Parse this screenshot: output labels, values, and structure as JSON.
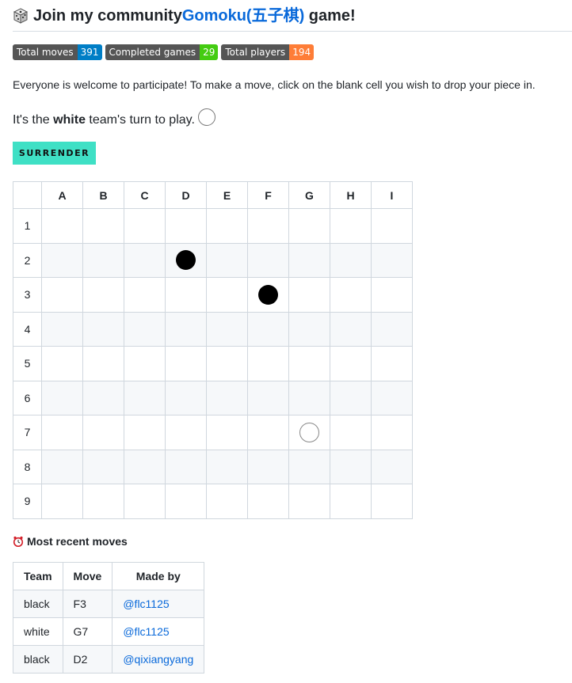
{
  "header": {
    "prefix": "Join my community ",
    "link_text": "Gomoku(五子棋)",
    "suffix": " game!",
    "icon": "dice-icon"
  },
  "badges": [
    {
      "label": "Total moves",
      "value": "391",
      "color": "#007ec6"
    },
    {
      "label": "Completed games",
      "value": "29",
      "color": "#4c1"
    },
    {
      "label": "Total players",
      "value": "194",
      "color": "#fe7d37"
    }
  ],
  "intro": "Everyone is welcome to participate! To make a move, click on the blank cell you wish to drop your piece in.",
  "turn": {
    "before": "It's the ",
    "team": "white",
    "after": " team's turn to play."
  },
  "surrender_label": "SURRENDER",
  "board": {
    "columns": [
      "A",
      "B",
      "C",
      "D",
      "E",
      "F",
      "G",
      "H",
      "I"
    ],
    "rows": [
      "1",
      "2",
      "3",
      "4",
      "5",
      "6",
      "7",
      "8",
      "9"
    ],
    "stones": [
      {
        "cell": "D2",
        "color": "black"
      },
      {
        "cell": "F3",
        "color": "black"
      },
      {
        "cell": "G7",
        "color": "white"
      }
    ]
  },
  "recent": {
    "title": "Most recent moves",
    "icon": "alarm-clock-icon",
    "headers": [
      "Team",
      "Move",
      "Made by"
    ],
    "rows": [
      {
        "team": "black",
        "move": "F3",
        "by": "@flc1125"
      },
      {
        "team": "white",
        "move": "G7",
        "by": "@flc1125"
      },
      {
        "team": "black",
        "move": "D2",
        "by": "@qixiangyang"
      }
    ]
  }
}
